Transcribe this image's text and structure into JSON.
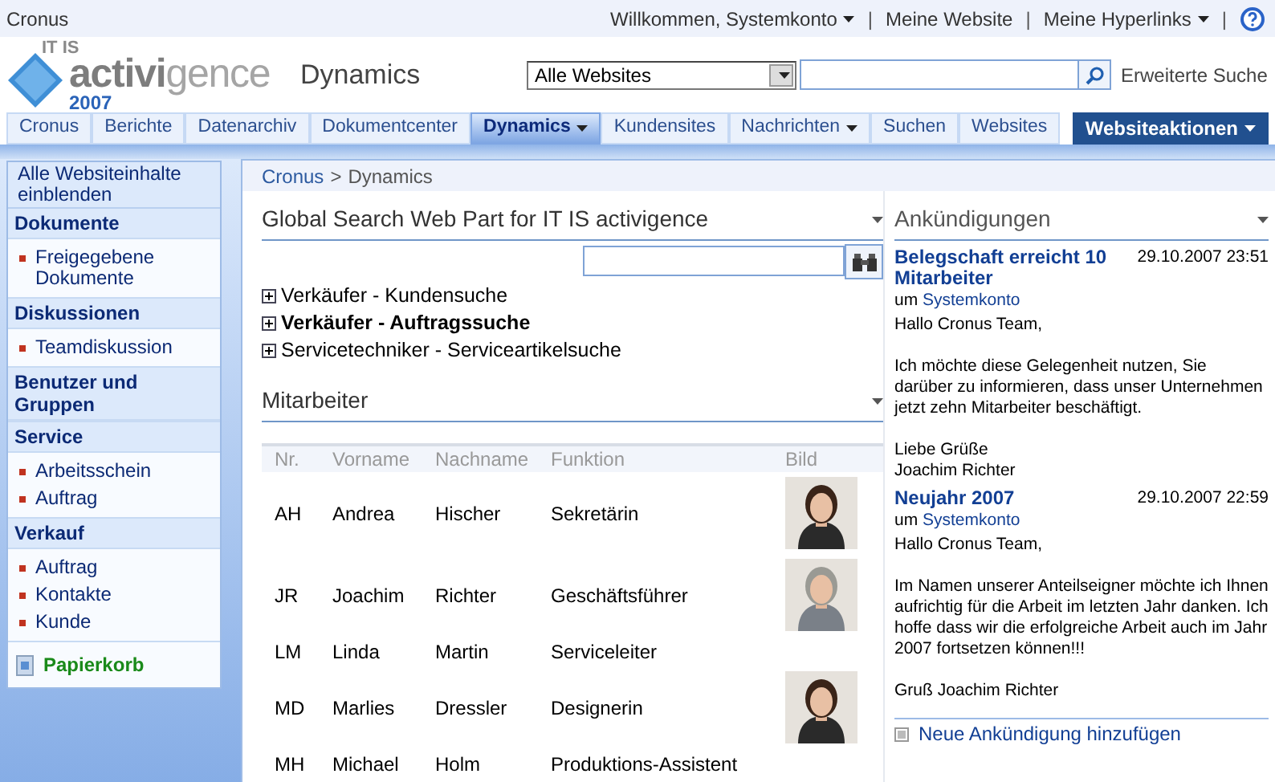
{
  "top_bar": {
    "site": "Cronus",
    "separator": "|",
    "links": [
      {
        "label": "Willkommen, Systemkonto",
        "dropdown": true
      },
      {
        "label": "Meine Website",
        "dropdown": false
      },
      {
        "label": "Meine Hyperlinks",
        "dropdown": true
      }
    ]
  },
  "logo": {
    "top": "IT IS",
    "bold": "activi",
    "light": "gence",
    "year": "2007",
    "product": "Dynamics"
  },
  "search": {
    "scope": "Alle Websites",
    "advanced": "Erweiterte Suche"
  },
  "tabs": [
    {
      "label": "Cronus",
      "selected": false,
      "dropdown": false
    },
    {
      "label": "Berichte",
      "selected": false,
      "dropdown": false
    },
    {
      "label": "Datenarchiv",
      "selected": false,
      "dropdown": false
    },
    {
      "label": "Dokumentcenter",
      "selected": false,
      "dropdown": false
    },
    {
      "label": "Dynamics",
      "selected": true,
      "dropdown": true
    },
    {
      "label": "Kundensites",
      "selected": false,
      "dropdown": false
    },
    {
      "label": "Nachrichten",
      "selected": false,
      "dropdown": true
    },
    {
      "label": "Suchen",
      "selected": false,
      "dropdown": false
    },
    {
      "label": "Websites",
      "selected": false,
      "dropdown": false
    }
  ],
  "site_actions": "Websiteaktionen",
  "sidebar": {
    "all_content": "Alle Websiteinhalte einblenden",
    "sections": [
      {
        "title": "Dokumente",
        "items": [
          "Freigegebene Dokumente"
        ]
      },
      {
        "title": "Diskussionen",
        "items": [
          "Teamdiskussion"
        ]
      },
      {
        "title": "Benutzer und Gruppen"
      },
      {
        "title": "Service",
        "items": [
          "Arbeitsschein",
          "Auftrag"
        ]
      },
      {
        "title": "Verkauf",
        "items": [
          "Auftrag",
          "Kontakte",
          "Kunde"
        ]
      }
    ],
    "recycle_bin": "Papierkorb"
  },
  "breadcrumb": {
    "link": "Cronus",
    "separator": ">",
    "current": "Dynamics"
  },
  "global_search": {
    "title": "Global Search Web Part for IT IS activigence",
    "items": [
      {
        "label": "Verkäufer - Kundensuche",
        "selected": false
      },
      {
        "label": "Verkäufer - Auftragssuche",
        "selected": true
      },
      {
        "label": "Servicetechniker - Serviceartikelsuche",
        "selected": false
      }
    ]
  },
  "employees": {
    "title": "Mitarbeiter",
    "columns": [
      "Nr.",
      "Vorname",
      "Nachname",
      "Funktion",
      "Bild"
    ],
    "rows": [
      {
        "cells": [
          "AH",
          "Andrea",
          "Hischer",
          "Sekretärin"
        ],
        "photo": {
          "kind": "picture"
        }
      },
      {
        "cells": [
          "JR",
          "Joachim",
          "Richter",
          "Geschäftsführer"
        ],
        "photo": {
          "kind": "picture"
        }
      },
      {
        "cells": [
          "LM",
          "Linda",
          "Martin",
          "Serviceleiter"
        ],
        "photo": null
      },
      {
        "cells": [
          "MD",
          "Marlies",
          "Dressler",
          "Designerin"
        ],
        "photo": {
          "kind": "picture"
        }
      },
      {
        "cells": [
          "MH",
          "Michael",
          "Holm",
          "Produktions-Assistent"
        ],
        "photo": null
      }
    ]
  },
  "announcements": {
    "title": "Ankündigungen",
    "items": [
      {
        "title": "Belegschaft erreicht 10 Mitarbeiter",
        "date": "29.10.2007 23:51",
        "by": "um",
        "author": "Systemkonto",
        "paragraphs": [
          [
            "Hallo Cronus Team,"
          ],
          [
            "Ich möchte diese Gelegenheit nutzen, Sie darüber zu informieren, dass unser Unternehmen jetzt zehn Mitarbeiter beschäftigt."
          ],
          [
            "Liebe Grüße",
            "Joachim Richter"
          ]
        ]
      },
      {
        "title": "Neujahr 2007",
        "date": "29.10.2007 22:59",
        "by": "um",
        "author": "Systemkonto",
        "paragraphs": [
          [
            "Hallo Cronus Team,"
          ],
          [
            "Im Namen unserer Anteilseigner möchte ich Ihnen aufrichtig für die Arbeit im letzten Jahr danken. Ich hoffe dass wir die erfolgreiche Arbeit auch im Jahr 2007 fortsetzen können!!!"
          ],
          [
            "Gruß Joachim Richter"
          ]
        ]
      }
    ],
    "add": "Neue Ankündigung hinzufügen"
  }
}
